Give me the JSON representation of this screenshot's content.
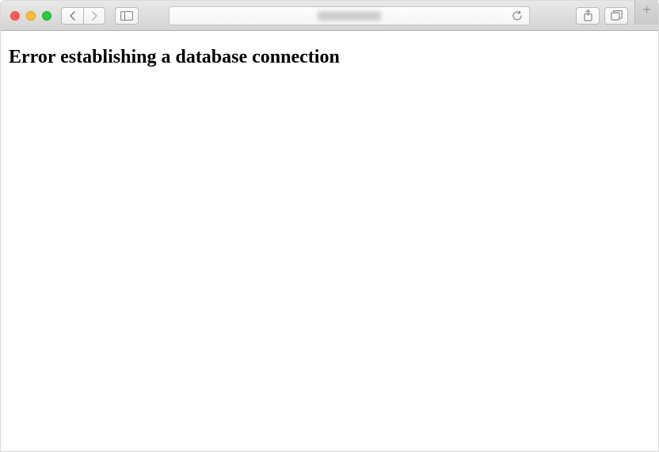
{
  "page": {
    "error_heading": "Error establishing a database connection"
  }
}
